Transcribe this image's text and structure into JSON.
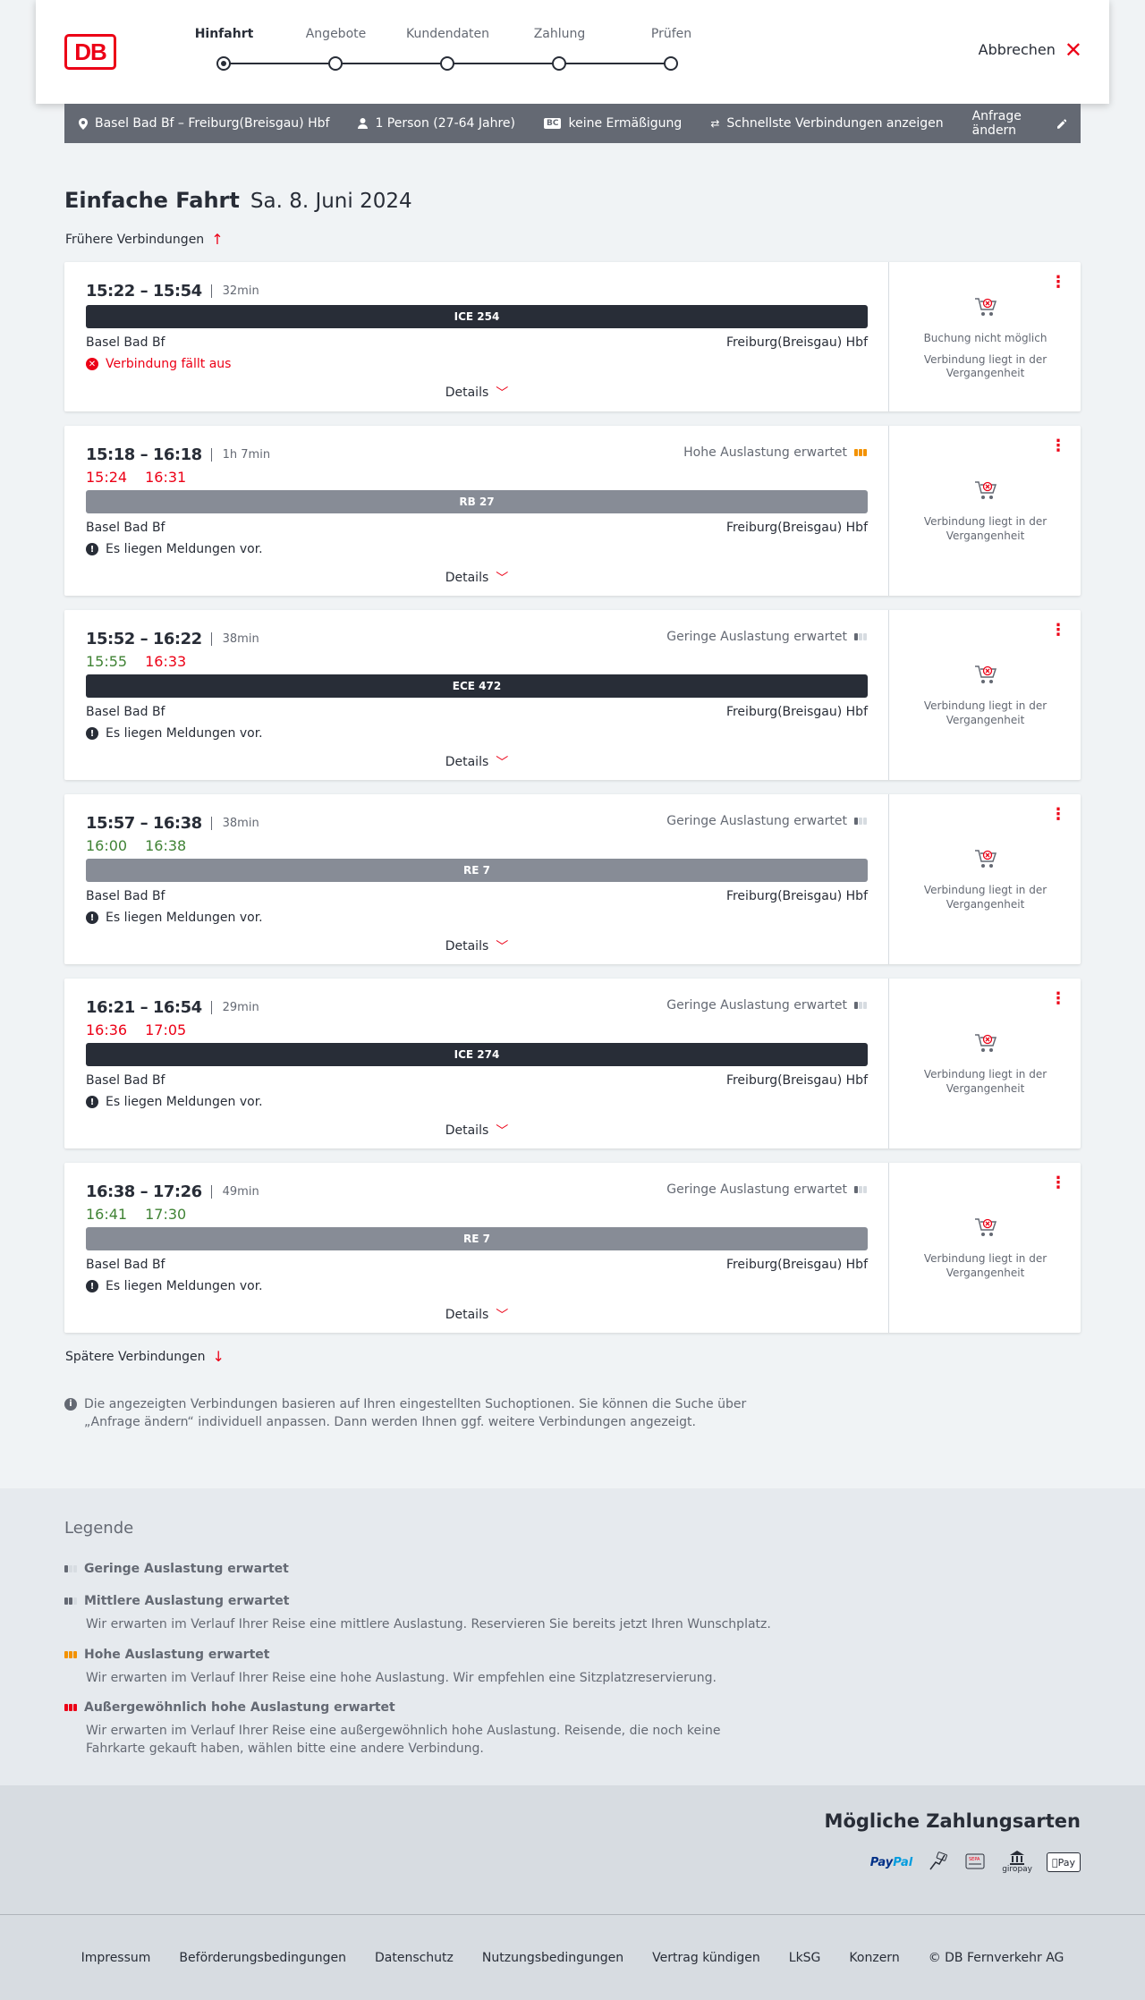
{
  "header": {
    "logo": "DB",
    "steps": [
      "Hinfahrt",
      "Angebote",
      "Kundendaten",
      "Zahlung",
      "Prüfen"
    ],
    "active_step": 0,
    "cancel_label": "Abbrechen"
  },
  "search": {
    "route": "Basel Bad Bf – Freiburg(Breisgau) Hbf",
    "passengers": "1 Person (27-64 Jahre)",
    "bc_badge": "BC",
    "discount": "keine Ermäßigung",
    "fastest": "Schnellste Verbindungen anzeigen",
    "change": "Anfrage ändern"
  },
  "page": {
    "title": "Einfache Fahrt",
    "date": "Sa. 8. Juni 2024",
    "earlier": "Frühere Verbindungen",
    "later": "Spätere Verbindungen",
    "info": "Die angezeigten Verbindungen basieren auf Ihren eingestellten Suchoptionen. Sie können die Suche über „Anfrage ändern“ individuell anpassen. Dann werden Ihnen ggf. weitere Verbindungen angezeigt."
  },
  "connections": [
    {
      "time": "15:22 – 15:54",
      "duration": "32min",
      "rt_dep": "",
      "rt_arr": "",
      "rt_dep_status": "",
      "rt_arr_status": "",
      "load": "",
      "train": "ICE 254",
      "train_style": "dark",
      "from": "Basel Bad Bf",
      "to": "Freiburg(Breisgau) Hbf",
      "notice": "Verbindung fällt aus",
      "notice_type": "cancel",
      "details": "Details",
      "side_lines": [
        "Buchung nicht möglich",
        "Verbindung liegt in der Vergangenheit"
      ]
    },
    {
      "time": "15:18 – 16:18",
      "duration": "1h 7min",
      "rt_dep": "15:24",
      "rt_arr": "16:31",
      "rt_dep_status": "late",
      "rt_arr_status": "late",
      "load": "Hohe Auslastung erwartet",
      "load_level": "high",
      "train": "RB 27",
      "train_style": "gray",
      "from": "Basel Bad Bf",
      "to": "Freiburg(Breisgau) Hbf",
      "notice": "Es liegen Meldungen vor.",
      "notice_type": "info",
      "details": "Details",
      "side_lines": [
        "Verbindung liegt in der Vergangenheit"
      ]
    },
    {
      "time": "15:52 – 16:22",
      "duration": "38min",
      "rt_dep": "15:55",
      "rt_arr": "16:33",
      "rt_dep_status": "ontime",
      "rt_arr_status": "late",
      "load": "Geringe Auslastung erwartet",
      "load_level": "low",
      "train": "ECE 472",
      "train_style": "dark",
      "from": "Basel Bad Bf",
      "to": "Freiburg(Breisgau) Hbf",
      "notice": "Es liegen Meldungen vor.",
      "notice_type": "info",
      "details": "Details",
      "side_lines": [
        "Verbindung liegt in der Vergangenheit"
      ]
    },
    {
      "time": "15:57 – 16:38",
      "duration": "38min",
      "rt_dep": "16:00",
      "rt_arr": "16:38",
      "rt_dep_status": "ontime",
      "rt_arr_status": "ontime",
      "load": "Geringe Auslastung erwartet",
      "load_level": "low",
      "train": "RE 7",
      "train_style": "gray",
      "from": "Basel Bad Bf",
      "to": "Freiburg(Breisgau) Hbf",
      "notice": "Es liegen Meldungen vor.",
      "notice_type": "info",
      "details": "Details",
      "side_lines": [
        "Verbindung liegt in der Vergangenheit"
      ]
    },
    {
      "time": "16:21 – 16:54",
      "duration": "29min",
      "rt_dep": "16:36",
      "rt_arr": "17:05",
      "rt_dep_status": "late",
      "rt_arr_status": "late",
      "load": "Geringe Auslastung erwartet",
      "load_level": "low",
      "train": "ICE 274",
      "train_style": "dark",
      "from": "Basel Bad Bf",
      "to": "Freiburg(Breisgau) Hbf",
      "notice": "Es liegen Meldungen vor.",
      "notice_type": "info",
      "details": "Details",
      "side_lines": [
        "Verbindung liegt in der Vergangenheit"
      ]
    },
    {
      "time": "16:38 – 17:26",
      "duration": "49min",
      "rt_dep": "16:41",
      "rt_arr": "17:30",
      "rt_dep_status": "ontime",
      "rt_arr_status": "ontime",
      "load": "Geringe Auslastung erwartet",
      "load_level": "low",
      "train": "RE 7",
      "train_style": "gray",
      "from": "Basel Bad Bf",
      "to": "Freiburg(Breisgau) Hbf",
      "notice": "Es liegen Meldungen vor.",
      "notice_type": "info",
      "details": "Details",
      "side_lines": [
        "Verbindung liegt in der Vergangenheit"
      ]
    }
  ],
  "legend": {
    "title": "Legende",
    "items": [
      {
        "label": "Geringe Auslastung erwartet",
        "desc": ""
      },
      {
        "label": "Mittlere Auslastung erwartet",
        "desc": "Wir erwarten im Verlauf Ihrer Reise eine mittlere Auslastung. Reservieren Sie bereits jetzt Ihren Wunschplatz."
      },
      {
        "label": "Hohe Auslastung erwartet",
        "desc": "Wir erwarten im Verlauf Ihrer Reise eine hohe Auslastung. Wir empfehlen eine Sitzplatzreservierung."
      },
      {
        "label": "Außergewöhnlich hohe Auslastung erwartet",
        "desc": "Wir erwarten im Verlauf Ihrer Reise eine außergewöhnlich hohe Auslastung. Reisende, die noch keine Fahrkarte gekauft haben, wählen bitte eine andere Verbindung."
      }
    ]
  },
  "payment": {
    "title": "Mögliche Zahlungsarten",
    "paypal_a": "Pay",
    "paypal_b": "Pal",
    "sepa": "SEPA",
    "giropay": "giropay",
    "applepay": "Pay"
  },
  "footer": {
    "links": [
      "Impressum",
      "Beförderungsbedingungen",
      "Datenschutz",
      "Nutzungsbedingungen",
      "Vertrag kündigen",
      "LkSG",
      "Konzern",
      "© DB Fernverkehr AG"
    ]
  },
  "colors": {
    "accent": "#ec0016",
    "ontime": "#408335",
    "high_load": "#f39200",
    "dark": "#282d37"
  }
}
